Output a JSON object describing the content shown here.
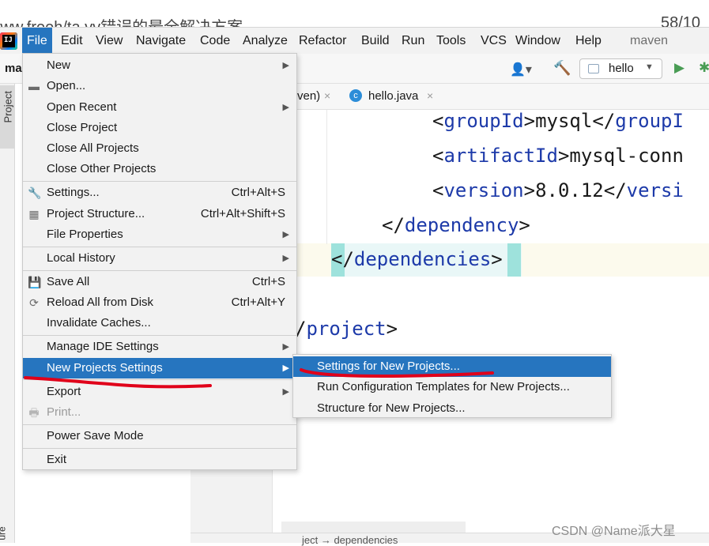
{
  "browser": {
    "title": "www.freeh/ta.vv错误的最全解决方案",
    "page_indicator": "58/10"
  },
  "menubar": {
    "items": [
      "File",
      "Edit",
      "View",
      "Navigate",
      "Code",
      "Analyze",
      "Refactor",
      "Build",
      "Run",
      "Tools",
      "VCS",
      "Window",
      "Help"
    ],
    "active": "File",
    "project_label": "maven"
  },
  "toolbar": {
    "project_name": "ma",
    "run_config": "hello"
  },
  "left_strip": {
    "project_tab": "Project",
    "structure_tab": "ure"
  },
  "editor": {
    "tabs": [
      {
        "label": "ven)",
        "close": "×"
      },
      {
        "label": "hello.java",
        "icon": "c",
        "close": "×"
      }
    ],
    "lines": [
      {
        "open": "<",
        "tag": "groupId",
        "close": ">",
        "text": "mysql",
        "end_open": "</",
        "end_tag": "groupI"
      },
      {
        "open": "<",
        "tag": "artifactId",
        "close": ">",
        "text": "mysql-conn"
      },
      {
        "open": "<",
        "tag": "version",
        "close": ">",
        "text": "8.0.12",
        "end_open": "</",
        "end_tag": "versi"
      },
      {
        "open": "</",
        "tag": "dependency",
        "close": ">"
      },
      {
        "open": "</",
        "tag": "dependencies",
        "close": ">"
      },
      {
        "open": "/",
        "tag": "project",
        "close": ">"
      }
    ],
    "bottom_text": "ject → dependencies"
  },
  "file_menu": {
    "items": [
      {
        "label": "New",
        "shortcut": "",
        "submenu": true
      },
      {
        "label": "Open...",
        "shortcut": "",
        "submenu": false,
        "icon": "folder-icon"
      },
      {
        "label": "Open Recent",
        "shortcut": "",
        "submenu": true
      },
      {
        "label": "Close Project",
        "shortcut": "",
        "submenu": false
      },
      {
        "label": "Close All Projects",
        "shortcut": "",
        "submenu": false
      },
      {
        "label": "Close Other Projects",
        "shortcut": "",
        "submenu": false
      },
      {
        "label": "Settings...",
        "shortcut": "Ctrl+Alt+S",
        "submenu": false,
        "icon": "wrench-icon"
      },
      {
        "label": "Project Structure...",
        "shortcut": "Ctrl+Alt+Shift+S",
        "submenu": false,
        "icon": "project-structure-icon"
      },
      {
        "label": "File Properties",
        "shortcut": "",
        "submenu": true
      },
      {
        "label": "Local History",
        "shortcut": "",
        "submenu": true
      },
      {
        "label": "Save All",
        "shortcut": "Ctrl+S",
        "submenu": false,
        "icon": "save-icon"
      },
      {
        "label": "Reload All from Disk",
        "shortcut": "Ctrl+Alt+Y",
        "submenu": false,
        "icon": "reload-icon"
      },
      {
        "label": "Invalidate Caches...",
        "shortcut": "",
        "submenu": false
      },
      {
        "label": "Manage IDE Settings",
        "shortcut": "",
        "submenu": true
      },
      {
        "label": "New Projects Settings",
        "shortcut": "",
        "submenu": true,
        "selected": true
      },
      {
        "label": "Export",
        "shortcut": "",
        "submenu": true
      },
      {
        "label": "Print...",
        "shortcut": "",
        "submenu": false,
        "disabled": true,
        "icon": "print-icon"
      },
      {
        "label": "Power Save Mode",
        "shortcut": "",
        "submenu": false
      },
      {
        "label": "Exit",
        "shortcut": "",
        "submenu": false
      }
    ]
  },
  "sub_menu": {
    "items": [
      {
        "label": "Settings for New Projects...",
        "selected": true
      },
      {
        "label": "Run Configuration Templates for New Projects..."
      },
      {
        "label": "Structure for New Projects..."
      }
    ]
  },
  "watermark": "CSDN @Name派大星",
  "colors": {
    "selection": "#2675bf",
    "menu_bg": "#f2f2f2",
    "xml_tag": "#1d3aa9",
    "annotation_red": "#e0001a",
    "brace_highlight": "#9ee2dc"
  }
}
